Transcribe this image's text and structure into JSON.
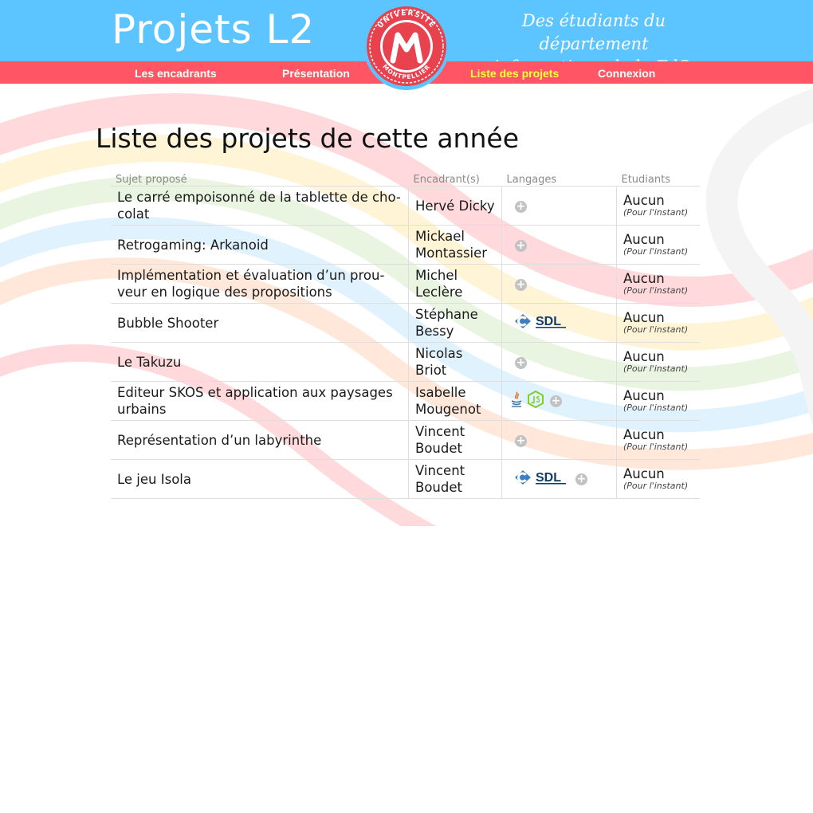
{
  "header": {
    "site_title": "Projets L2",
    "tagline_line1": "Des étudiants du département",
    "tagline_line2": "informatique de la FdS.",
    "logo_text_top": "UNIVERSITÉ",
    "logo_text_bottom": "MONTPELLIER"
  },
  "nav": {
    "items": [
      {
        "label": "Les encadrants"
      },
      {
        "label": "Présentation"
      },
      {
        "label": "Liste des projets",
        "active": true
      },
      {
        "label": "Connexion"
      }
    ]
  },
  "colors": {
    "topbar": "#5cc5ff",
    "navbar": "#ff5564",
    "nav_active": "#ffff45",
    "logo_red": "#e8424f"
  },
  "page": {
    "heading": "Liste des projets de cette année"
  },
  "table": {
    "columns": [
      "Sujet proposé",
      "Encadrant(s)",
      "Langages",
      "Etudiants"
    ],
    "rows": [
      {
        "subject": "Le carré empoisonné de la tablette de cho-colat",
        "subject_l1": "Le carré empoisonné de la tablette de cho-",
        "subject_l2": "colat",
        "supervisor": "Hervé Dicky",
        "sup_l1": "Hervé Dicky",
        "sup_l2": "",
        "languages": [
          "plus"
        ],
        "students": "Aucun",
        "students_note": "(Pour l'instant)"
      },
      {
        "subject": "Retrogaming: Arkanoid",
        "subject_l1": "Retrogaming: Arkanoid",
        "subject_l2": "",
        "supervisor": "Mickael Montassier",
        "sup_l1": "Mickael",
        "sup_l2": "Montassier",
        "languages": [
          "plus"
        ],
        "students": "Aucun",
        "students_note": "(Pour l'instant)"
      },
      {
        "subject": "Implémentation et évaluation d'un prou-veur en logique des propositions",
        "subject_l1": "Implémentation et évaluation d’un prou-",
        "subject_l2": "veur en logique des propositions",
        "supervisor": "Michel Leclère",
        "sup_l1": "Michel",
        "sup_l2": "Leclère",
        "languages": [
          "plus"
        ],
        "students": "Aucun",
        "students_note": "(Pour l'instant)"
      },
      {
        "subject": "Bubble Shooter",
        "subject_l1": "Bubble Shooter",
        "subject_l2": "",
        "supervisor": "Stéphane Bessy",
        "sup_l1": "Stéphane",
        "sup_l2": "Bessy",
        "languages": [
          "c",
          "sdl"
        ],
        "students": "Aucun",
        "students_note": "(Pour l'instant)"
      },
      {
        "subject": "Le Takuzu",
        "subject_l1": "Le Takuzu",
        "subject_l2": "",
        "supervisor": "Nicolas Briot",
        "sup_l1": "Nicolas Briot",
        "sup_l2": "",
        "languages": [
          "plus"
        ],
        "students": "Aucun",
        "students_note": "(Pour l'instant)"
      },
      {
        "subject": "Editeur SKOS et application aux paysages urbains",
        "subject_l1": "Editeur SKOS et application aux paysages",
        "subject_l2": "urbains",
        "supervisor": "Isabelle Mougenot",
        "sup_l1": "Isabelle",
        "sup_l2": "Mougenot",
        "languages": [
          "java",
          "nodejs",
          "plus"
        ],
        "students": "Aucun",
        "students_note": "(Pour l'instant)"
      },
      {
        "subject": "Représentation d'un labyrinthe",
        "subject_l1": "Représentation d’un labyrinthe",
        "subject_l2": "",
        "supervisor": "Vincent Boudet",
        "sup_l1": "Vincent",
        "sup_l2": "Boudet",
        "languages": [
          "plus"
        ],
        "students": "Aucun",
        "students_note": "(Pour l'instant)"
      },
      {
        "subject": "Le jeu Isola",
        "subject_l1": "Le jeu Isola",
        "subject_l2": "",
        "supervisor": "Vincent Boudet",
        "sup_l1": "Vincent",
        "sup_l2": "Boudet",
        "languages": [
          "c",
          "sdl",
          "plus"
        ],
        "students": "Aucun",
        "students_note": "(Pour l'instant)"
      }
    ]
  },
  "icons": {
    "plus": "plus-circle-icon",
    "c": "c-language-icon",
    "sdl": "sdl-logo-icon",
    "java": "java-icon",
    "nodejs": "nodejs-icon"
  },
  "sdl_text": "SDL"
}
